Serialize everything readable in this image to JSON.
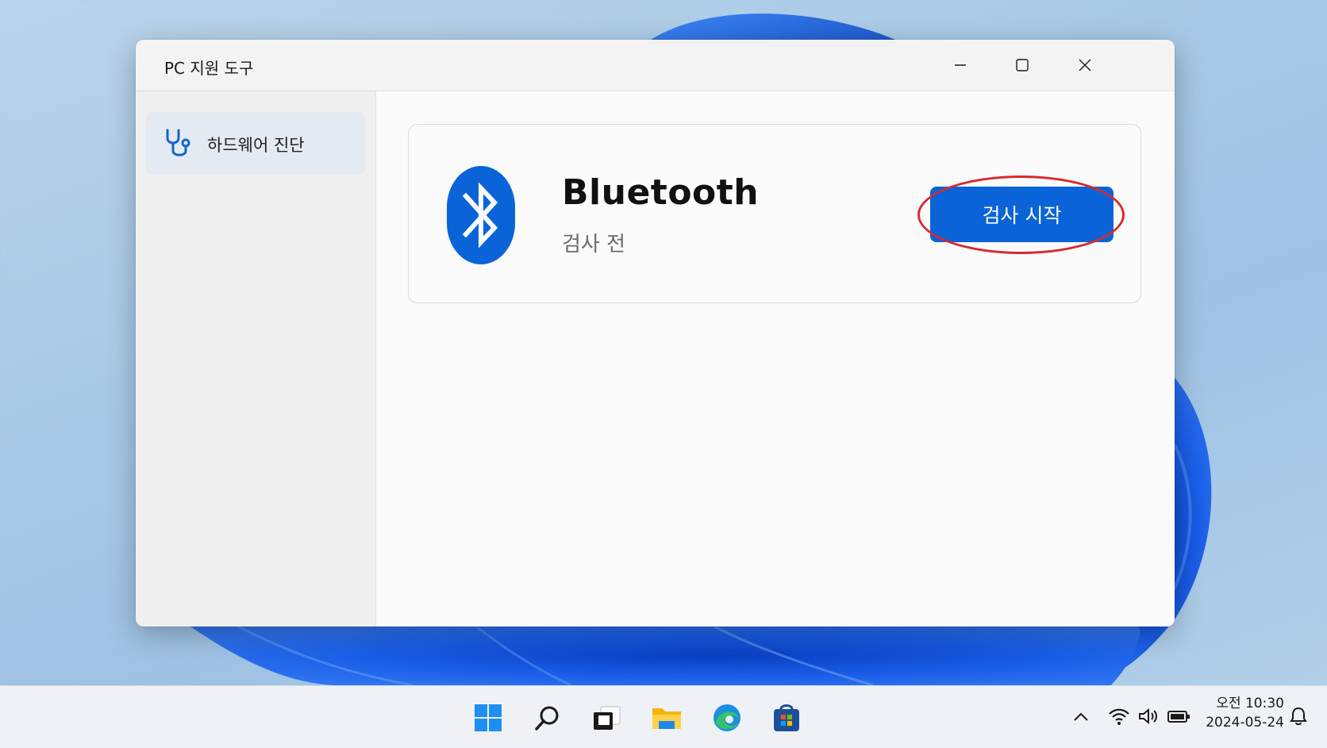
{
  "window": {
    "title": "PC 지원 도구"
  },
  "sidebar": {
    "items": [
      {
        "label": "하드웨어 진단",
        "icon": "stethoscope-icon",
        "selected": true
      }
    ]
  },
  "device_card": {
    "name": "Bluetooth",
    "status": "검사 전",
    "icon": "bluetooth-icon",
    "action_label": "검사 시작"
  },
  "taskbar": {
    "apps": [
      "start-icon",
      "search-icon",
      "task-view-icon",
      "file-explorer-icon",
      "edge-icon",
      "store-icon"
    ],
    "clock": {
      "time": "오전 10:30",
      "date": "2024-05-24"
    }
  },
  "colors": {
    "accent": "#0a64d8",
    "highlight": "#d9282f"
  }
}
